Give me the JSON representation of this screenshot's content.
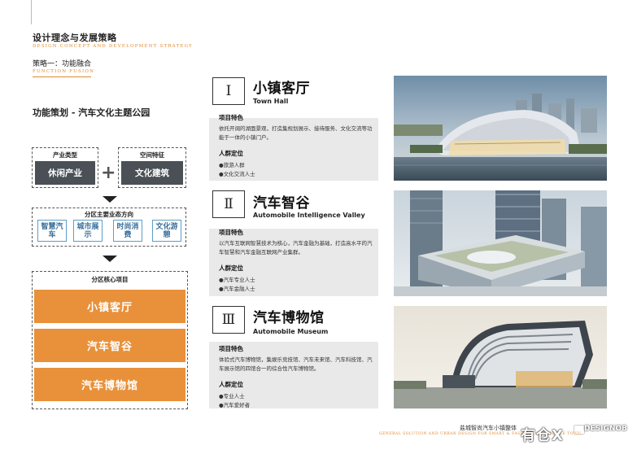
{
  "header": {
    "title": "设计理念与发展策略",
    "title_en": "DESIGN CONCEPT AND DEVELOPMENT STRATEGY",
    "subtitle": "策略一：功能融合",
    "subtitle_en": "FUNCTION FUSION"
  },
  "left": {
    "section_title": "功能策划 - 汽车文化主题公园",
    "industry_label": "产业类型",
    "industry_value": "休闲产业",
    "plus": "+",
    "space_label": "空间特征",
    "space_value": "文化建筑",
    "formats_label": "分区主要业态方向",
    "formats": [
      "智慧汽车",
      "城市展示",
      "时尚消费",
      "文化游憩"
    ],
    "core_label": "分区核心项目",
    "core_projects": [
      "小镇客厅",
      "汽车智谷",
      "汽车博物馆"
    ]
  },
  "panels": [
    {
      "numeral": "Ⅰ",
      "title": "小镇客厅",
      "title_en": "Town Hall",
      "feature_head": "项目特色",
      "feature_text": "依托开阔的湖面景观，打造集规划展示、接待服务、文化交流等功能于一体的小镇门户。",
      "crowd_head": "人群定位",
      "crowd": [
        "●旅游人群",
        "●文化交流人士"
      ]
    },
    {
      "numeral": "Ⅱ",
      "title": "汽车智谷",
      "title_en": "Automobile Intelligence Valley",
      "feature_head": "项目特色",
      "feature_text": "以汽车互联网智慧技术为核心，汽车金融为基础，打造高水平的汽车智慧和汽车金融互联网产业集群。",
      "crowd_head": "人群定位",
      "crowd": [
        "●汽车专业人士",
        "●汽车金融人士"
      ]
    },
    {
      "numeral": "Ⅲ",
      "title": "汽车博物馆",
      "title_en": "Automobile Museum",
      "feature_head": "项目特色",
      "feature_text": "体验式汽车博物馆，集娱乐竞技馆、汽车未来馆、汽车科技馆、汽车展示馆的四馆合一的综合性汽车博物馆。",
      "crowd_head": "人群定位",
      "crowd": [
        "●专业人士",
        "●汽车爱好者"
      ]
    }
  ],
  "footer": {
    "cn": "盐城智尚汽车小镇整体",
    "en": "GENERAL SOLUTION AND URBAN DESIGN FOR SMART & FASHION AUTOMOBILE TOWN",
    "watermark": "有仓X",
    "watermark_brand": "DESIGNOB"
  },
  "colors": {
    "accent": "#e8913a",
    "dark_tile": "#4a5056",
    "panel_bg": "#e9e9e9",
    "mini_border": "#5aa0c8"
  }
}
